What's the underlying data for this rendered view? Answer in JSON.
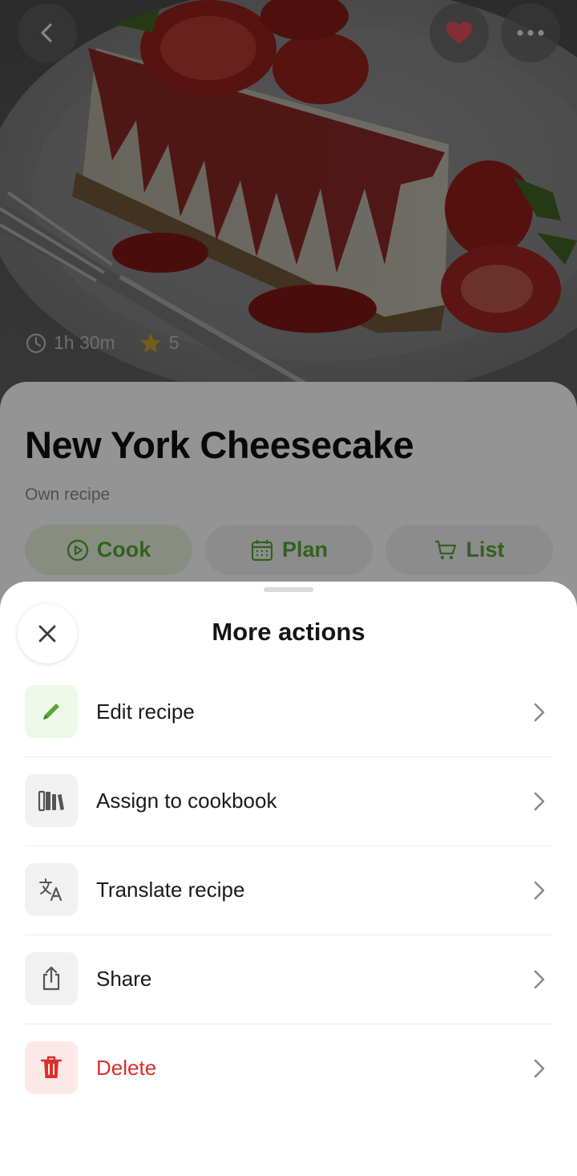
{
  "recipe": {
    "title": "New York Cheesecake",
    "source": "Own recipe",
    "duration": "1h 30m",
    "rating": "5",
    "actions": {
      "cook": "Cook",
      "plan": "Plan",
      "list": "List"
    }
  },
  "header": {
    "back_icon": "chevron-left-icon",
    "favorite_icon": "heart-icon",
    "more_icon": "more-horizontal-icon"
  },
  "sheet": {
    "title": "More actions",
    "close_icon": "close-icon",
    "items": [
      {
        "label": "Edit recipe",
        "icon": "pencil-icon"
      },
      {
        "label": "Assign to cookbook",
        "icon": "books-icon"
      },
      {
        "label": "Translate recipe",
        "icon": "translate-icon"
      },
      {
        "label": "Share",
        "icon": "share-icon"
      },
      {
        "label": "Delete",
        "icon": "trash-icon"
      }
    ]
  },
  "colors": {
    "accent_green": "#5aa63a",
    "accent_green_bg": "#e9f5df",
    "danger_red": "#d9302c",
    "danger_bg": "#fde8e8",
    "heart_red": "#e0505a",
    "star_gold": "#f2b21a"
  }
}
